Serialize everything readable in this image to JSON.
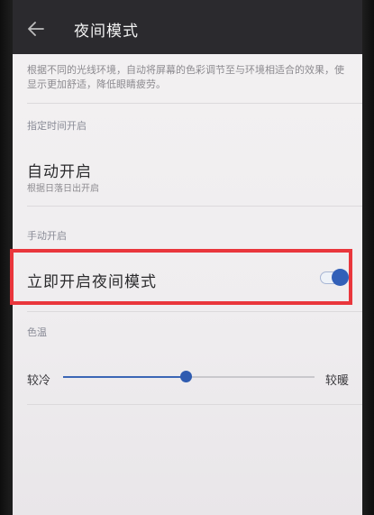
{
  "header": {
    "title": "夜间模式",
    "back_icon": "arrow-left-icon"
  },
  "description": "根据不同的光线环境，自动将屏幕的色彩调节至与环境相适合的效果，使显示更加舒适，降低眼睛疲劳。",
  "scheduled": {
    "section_label": "指定时间开启",
    "auto_title": "自动开启",
    "auto_subtitle": "根据日落日出开启"
  },
  "manual": {
    "section_label": "手动开启",
    "now_title": "立即开启夜间模式",
    "toggle_on": true
  },
  "color_temp": {
    "section_label": "色温",
    "min_label": "较冷",
    "max_label": "较暖",
    "value_fraction": 0.49
  },
  "colors": {
    "accent": "#3260b8",
    "highlight": "#e9363c",
    "appbar": "#2b2a2e"
  }
}
